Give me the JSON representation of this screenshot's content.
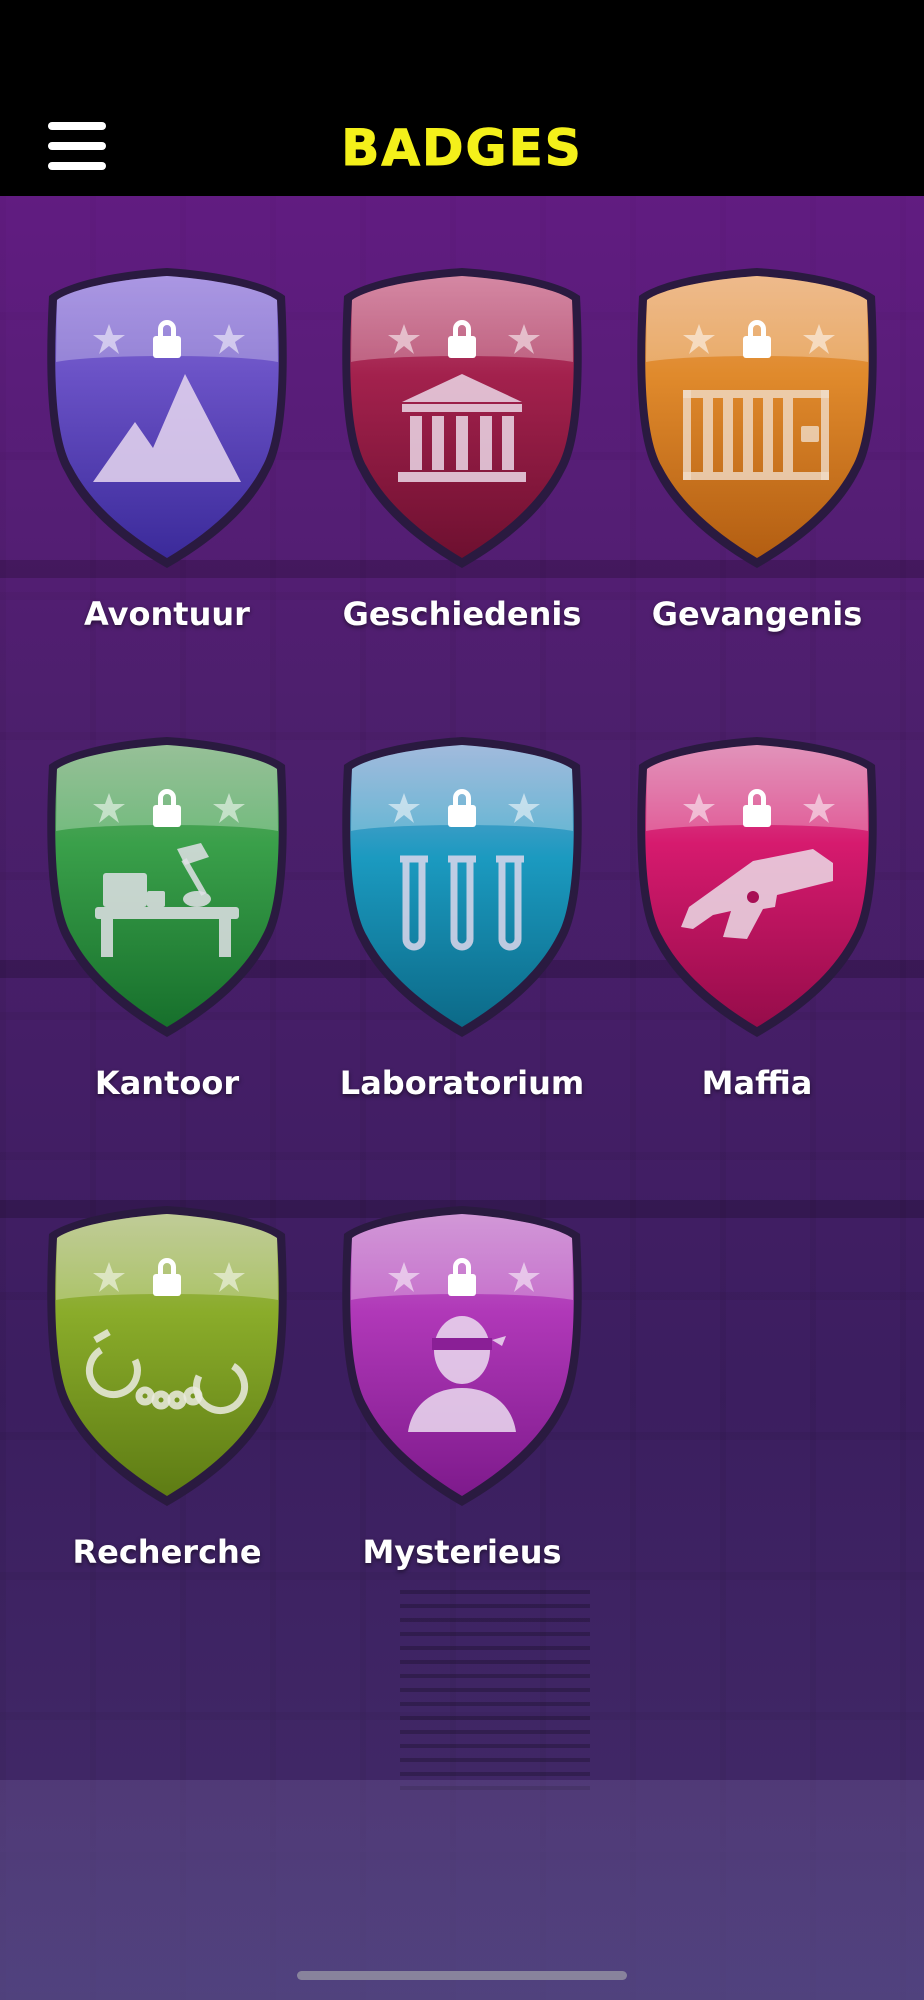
{
  "header": {
    "title": "BADGES",
    "menu_icon": "hamburger-menu-icon"
  },
  "badges": [
    {
      "label": "Avontuur",
      "icon": "mountain-icon",
      "color": "#5b3fb8",
      "color_dark": "#3b2a9a",
      "locked": true
    },
    {
      "label": "Geschiedenis",
      "icon": "museum-icon",
      "color": "#a3214d",
      "color_dark": "#7a1238",
      "locked": true
    },
    {
      "label": "Gevangenis",
      "icon": "prison-cell-icon",
      "color": "#e08a2c",
      "color_dark": "#c36a1a",
      "locked": true
    },
    {
      "label": "Kantoor",
      "icon": "office-desk-icon",
      "color": "#3aa04a",
      "color_dark": "#1f7a34",
      "locked": true
    },
    {
      "label": "Laboratorium",
      "icon": "test-tubes-icon",
      "color": "#1b9ac0",
      "color_dark": "#107a9c",
      "locked": true
    },
    {
      "label": "Maffia",
      "icon": "pistol-icon",
      "color": "#d61a6e",
      "color_dark": "#a80f54",
      "locked": true
    },
    {
      "label": "Recherche",
      "icon": "handcuffs-icon",
      "color": "#8aac2a",
      "color_dark": "#6a8f1a",
      "locked": true
    },
    {
      "label": "Mysterieus",
      "icon": "masked-person-icon",
      "color": "#b038b8",
      "color_dark": "#8a1f96",
      "locked": true
    }
  ]
}
